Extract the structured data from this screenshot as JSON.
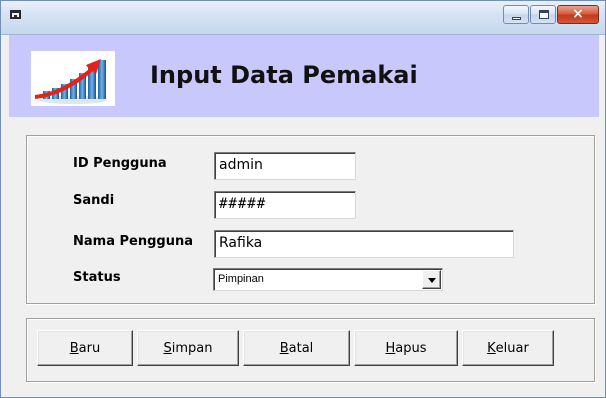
{
  "window": {
    "title": "",
    "icon": "form-icon",
    "controls": {
      "minimize": "minimize-icon",
      "maximize": "maximize-icon",
      "close": "×"
    }
  },
  "header": {
    "title": "Input Data Pemakai",
    "logo_icon": "growth-chart-icon",
    "background": "#c8c8fc"
  },
  "form": {
    "id_pengguna": {
      "label": "ID Pengguna",
      "value": "admin"
    },
    "sandi": {
      "label": "Sandi",
      "value": "#####"
    },
    "nama_pengguna": {
      "label": "Nama Pengguna",
      "value": "Rafika"
    },
    "status": {
      "label": "Status",
      "value": "Pimpinan"
    }
  },
  "buttons": [
    {
      "key": "B",
      "rest": "aru"
    },
    {
      "key": "S",
      "rest": "impan"
    },
    {
      "key": "B",
      "rest": "atal"
    },
    {
      "key": "H",
      "rest": "apus"
    },
    {
      "key": "K",
      "rest": "eluar"
    }
  ]
}
